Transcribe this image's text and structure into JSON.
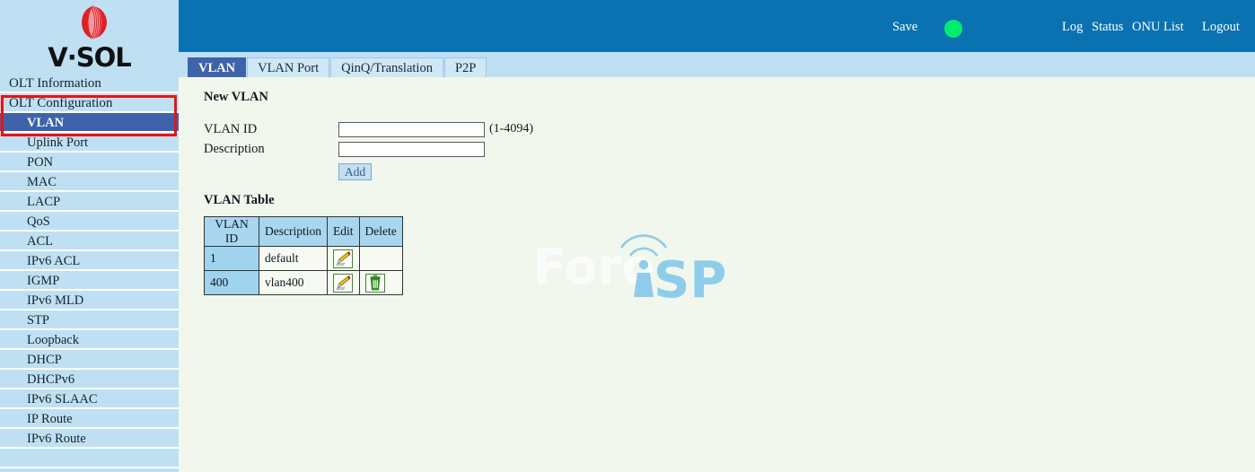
{
  "brand": {
    "logo_text": "V·SOL",
    "logo_icon": "vsol-sphere-logo"
  },
  "topbar": {
    "save_label": "Save",
    "status_dot_color": "#00ee6e",
    "log_label": "Log",
    "status_label": "Status",
    "onu_list_label": "ONU List",
    "logout_label": "Logout",
    "background_color": "#0a72b0"
  },
  "sidebar": {
    "highlight_color": "#ee1111",
    "item_background": "#bfe0f3",
    "selected_background": "#3e63ab",
    "items": [
      {
        "label": "OLT Information",
        "level": 1,
        "selected": false
      },
      {
        "label": "OLT Configuration",
        "level": 1,
        "selected": false
      },
      {
        "label": "VLAN",
        "level": 2,
        "selected": true
      },
      {
        "label": "Uplink Port",
        "level": 2,
        "selected": false
      },
      {
        "label": "PON",
        "level": 2,
        "selected": false
      },
      {
        "label": "MAC",
        "level": 2,
        "selected": false
      },
      {
        "label": "LACP",
        "level": 2,
        "selected": false
      },
      {
        "label": "QoS",
        "level": 2,
        "selected": false
      },
      {
        "label": "ACL",
        "level": 2,
        "selected": false
      },
      {
        "label": "IPv6 ACL",
        "level": 2,
        "selected": false
      },
      {
        "label": "IGMP",
        "level": 2,
        "selected": false
      },
      {
        "label": "IPv6 MLD",
        "level": 2,
        "selected": false
      },
      {
        "label": "STP",
        "level": 2,
        "selected": false
      },
      {
        "label": "Loopback",
        "level": 2,
        "selected": false
      },
      {
        "label": "DHCP",
        "level": 2,
        "selected": false
      },
      {
        "label": "DHCPv6",
        "level": 2,
        "selected": false
      },
      {
        "label": "IPv6 SLAAC",
        "level": 2,
        "selected": false
      },
      {
        "label": "IP Route",
        "level": 2,
        "selected": false
      },
      {
        "label": "IPv6 Route",
        "level": 2,
        "selected": false
      },
      {
        "label": "",
        "level": 2,
        "selected": false
      }
    ]
  },
  "tabs": [
    {
      "label": "VLAN",
      "active": true
    },
    {
      "label": "VLAN Port",
      "active": false
    },
    {
      "label": "QinQ/Translation",
      "active": false
    },
    {
      "label": "P2P",
      "active": false
    }
  ],
  "new_vlan": {
    "section_title": "New VLAN",
    "vlan_id_label": "VLAN ID",
    "vlan_id_value": "",
    "vlan_id_placeholder": "",
    "vlan_id_hint": "(1-4094)",
    "description_label": "Description",
    "description_value": "",
    "description_placeholder": "",
    "add_label": "Add"
  },
  "vlan_table": {
    "title": "VLAN Table",
    "columns": [
      "VLAN ID",
      "Description",
      "Edit",
      "Delete"
    ],
    "rows": [
      {
        "vlan_id": "1",
        "description": "default",
        "edit_icon": "pencil-icon",
        "delete_icon": ""
      },
      {
        "vlan_id": "400",
        "description": "vlan400",
        "edit_icon": "pencil-icon",
        "delete_icon": "trash-icon"
      }
    ]
  },
  "watermark": {
    "text_light": "Foro",
    "text_blue": "iSP",
    "icon": "wifi-antenna-icon"
  }
}
